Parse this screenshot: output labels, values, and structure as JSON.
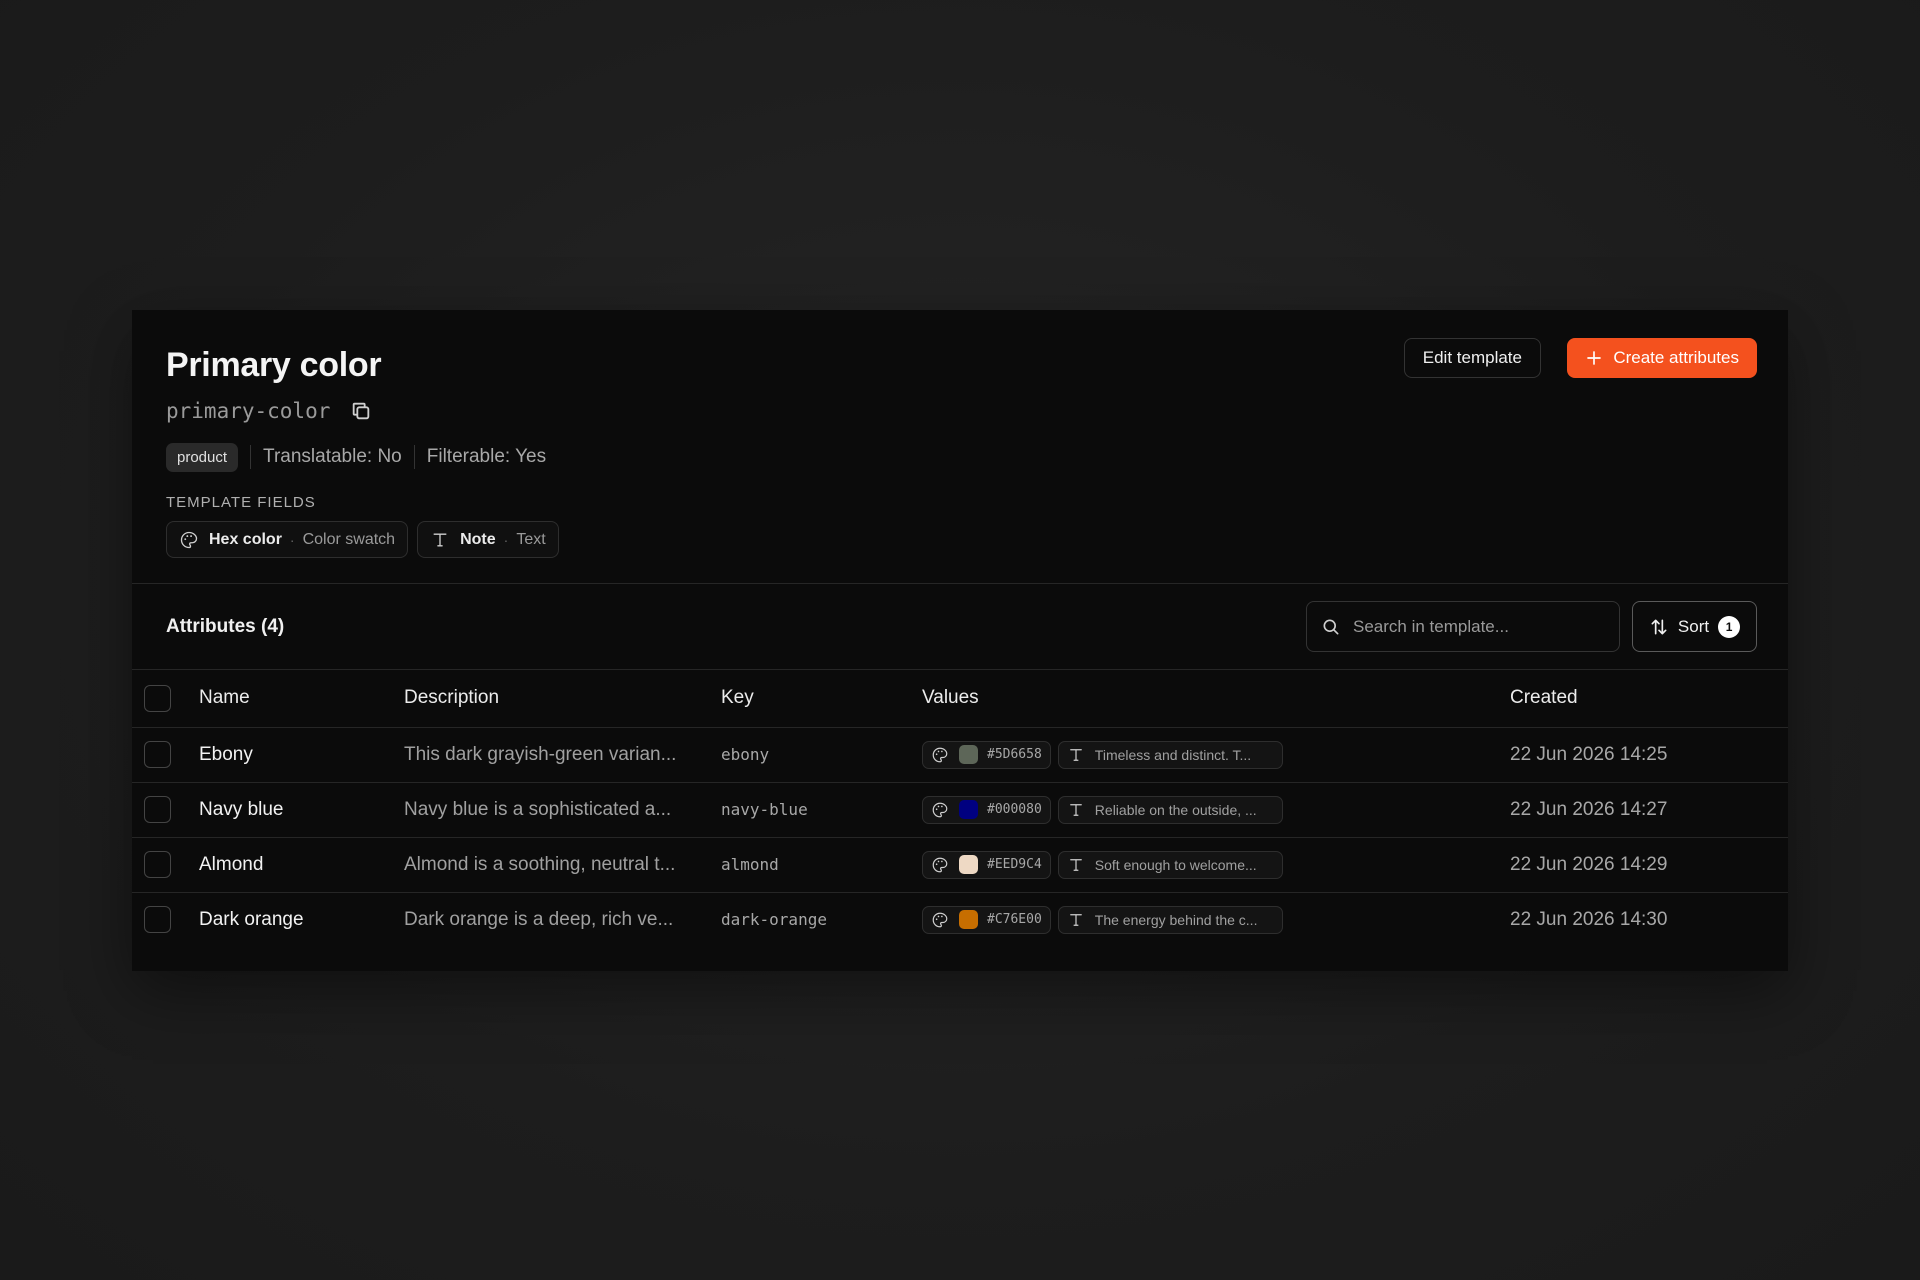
{
  "header": {
    "title": "Primary color",
    "key": "primary-color",
    "badge": "product",
    "translatable": "Translatable: No",
    "filterable": "Filterable: Yes",
    "template_fields_label": "TEMPLATE FIELDS",
    "fields": [
      {
        "name": "Hex color",
        "type": "Color swatch",
        "icon": "palette-icon"
      },
      {
        "name": "Note",
        "type": "Text",
        "icon": "text-icon"
      }
    ],
    "edit_label": "Edit template",
    "create_label": "Create attributes"
  },
  "toolbar": {
    "title": "Attributes (4)",
    "search_placeholder": "Search in template...",
    "sort_label": "Sort",
    "sort_count": "1"
  },
  "table": {
    "columns": [
      "Name",
      "Description",
      "Key",
      "Values",
      "Created"
    ],
    "rows": [
      {
        "name": "Ebony",
        "description": "This dark grayish-green varian...",
        "key": "ebony",
        "hex": "#5D6658",
        "color": "#5D6658",
        "note": "Timeless and distinct. T...",
        "created": "22 Jun 2026 14:25"
      },
      {
        "name": "Navy blue",
        "description": "Navy blue is a sophisticated a...",
        "key": "navy-blue",
        "hex": "#000080",
        "color": "#000080",
        "note": "Reliable on the outside, ...",
        "created": "22 Jun 2026 14:27"
      },
      {
        "name": "Almond",
        "description": "Almond is a soothing, neutral t...",
        "key": "almond",
        "hex": "#EED9C4",
        "color": "#EED9C4",
        "note": "Soft enough to welcome...",
        "created": "22 Jun 2026 14:29"
      },
      {
        "name": "Dark orange",
        "description": "Dark orange is a deep, rich ve...",
        "key": "dark-orange",
        "hex": "#C76E00",
        "color": "#C76E00",
        "note": "The energy behind the c...",
        "created": "22 Jun 2026 14:30"
      }
    ]
  },
  "colors": {
    "accent": "#F4511E",
    "panel": "#0B0B0B"
  }
}
